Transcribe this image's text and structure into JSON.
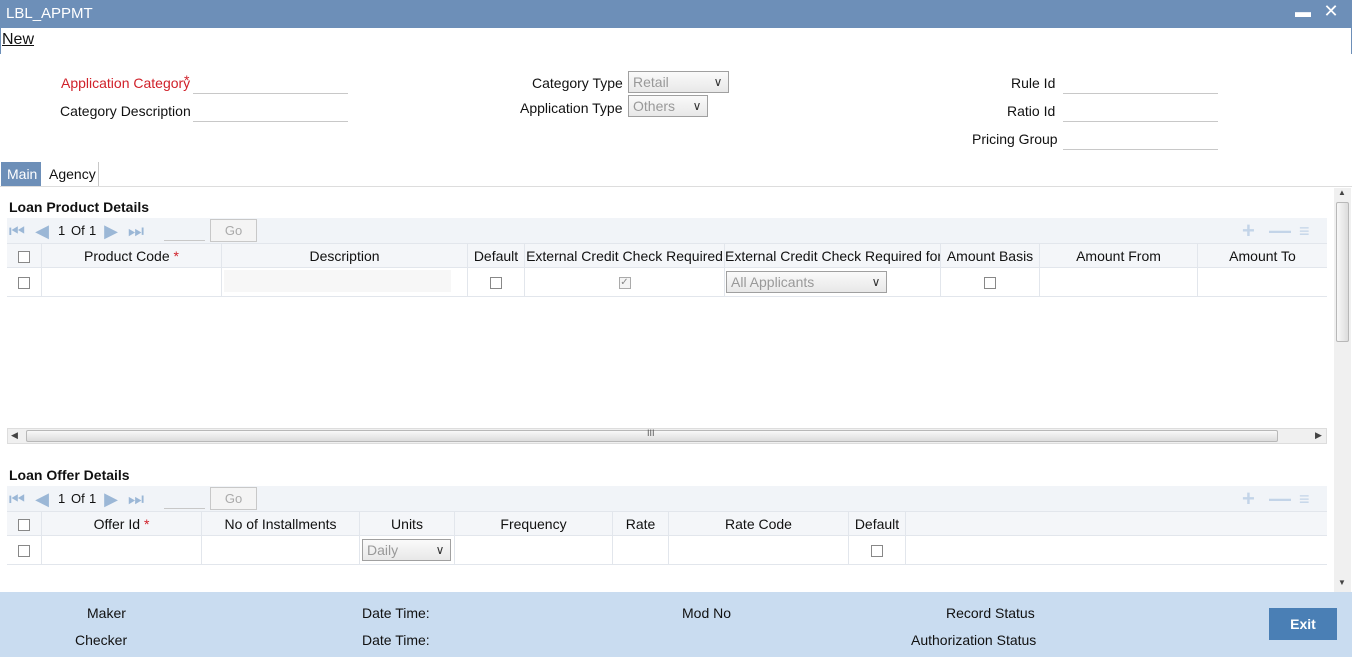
{
  "window": {
    "title": "LBL_APPMT"
  },
  "menu": {
    "new_label": "New"
  },
  "form": {
    "application_category_label": "Application Category",
    "application_category_value": "",
    "category_description_label": "Category Description",
    "category_description_value": "",
    "category_type_label": "Category Type",
    "category_type_value": "Retail",
    "application_type_label": "Application Type",
    "application_type_value": "Others",
    "rule_id_label": "Rule Id",
    "ratio_id_label": "Ratio Id",
    "pricing_group_label": "Pricing Group",
    "required_mark": "*"
  },
  "tabs": [
    {
      "label": "Main",
      "active": true
    },
    {
      "label": "Agency",
      "active": false
    }
  ],
  "loan_product": {
    "title": "Loan Product Details",
    "pager": {
      "current": "1",
      "of_label": "Of",
      "total": "1",
      "go_label": "Go"
    },
    "columns": [
      "Product Code",
      "Description",
      "Default",
      "External Credit Check Required",
      "External Credit Check Required for",
      "Amount Basis",
      "Amount From",
      "Amount To"
    ],
    "row": {
      "credit_check_for": "All Applicants",
      "credit_check_required": true
    }
  },
  "loan_offer": {
    "title": "Loan Offer Details",
    "pager": {
      "current": "1",
      "of_label": "Of",
      "total": "1",
      "go_label": "Go"
    },
    "columns": [
      "Offer Id",
      "No of Installments",
      "Units",
      "Frequency",
      "Rate",
      "Rate Code",
      "Default"
    ],
    "row": {
      "units": "Daily"
    }
  },
  "scroll_thumb_glyph": "III",
  "footer": {
    "maker": "Maker",
    "checker": "Checker",
    "date_time_1": "Date Time:",
    "date_time_2": "Date Time:",
    "mod_no": "Mod No",
    "record_status": "Record Status",
    "authorization_status": "Authorization Status",
    "exit_label": "Exit"
  },
  "colors": {
    "title_bar": "#6d8fb8",
    "footer": "#c9dcf0",
    "required": "#d0212a",
    "exit_button": "#4a7fb5"
  }
}
